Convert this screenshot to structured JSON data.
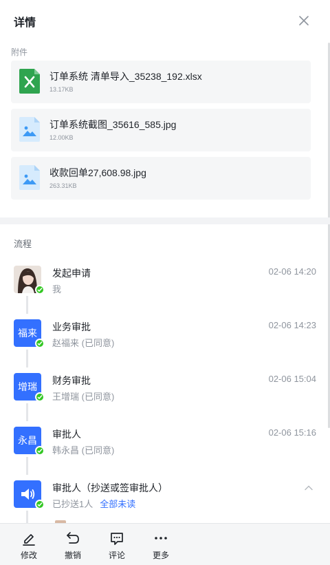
{
  "header": {
    "title": "详情",
    "close_icon": "close-icon"
  },
  "attachments": {
    "label": "附件",
    "items": [
      {
        "name": "订单系统 清单导入_35238_192.xlsx",
        "size": "13.17KB",
        "type": "excel"
      },
      {
        "name": "订单系统截图_35616_585.jpg",
        "size": "12.00KB",
        "type": "image"
      },
      {
        "name": "收款回单27,608.98.jpg",
        "size": "263.31KB",
        "type": "image"
      }
    ]
  },
  "flow": {
    "label": "流程",
    "steps": [
      {
        "title": "发起申请",
        "sub": "我",
        "time": "02-06 14:20",
        "avatar": "photo"
      },
      {
        "title": "业务审批",
        "sub": "赵福来 (已同意)",
        "time": "02-06 14:23",
        "avatar_text": "福来"
      },
      {
        "title": "财务审批",
        "sub": "王增瑞 (已同意)",
        "time": "02-06 15:04",
        "avatar_text": "增瑞"
      },
      {
        "title": "审批人",
        "sub": "韩永昌 (已同意)",
        "time": "02-06 15:16",
        "avatar_text": "永昌"
      },
      {
        "title": "审批人（抄送或签审批人）",
        "sub": "已抄送1人",
        "link": "全部未读",
        "avatar": "megaphone-icon"
      }
    ]
  },
  "bottom_bar": {
    "actions": [
      {
        "label": "修改",
        "icon": "pencil-icon"
      },
      {
        "label": "撤销",
        "icon": "undo-icon"
      },
      {
        "label": "评论",
        "icon": "comment-icon"
      },
      {
        "label": "更多",
        "icon": "more-icon"
      }
    ]
  },
  "colors": {
    "accent": "#3370ff",
    "success": "#34c724",
    "excel": "#2fa44f",
    "image_file": "#3d9af5"
  }
}
